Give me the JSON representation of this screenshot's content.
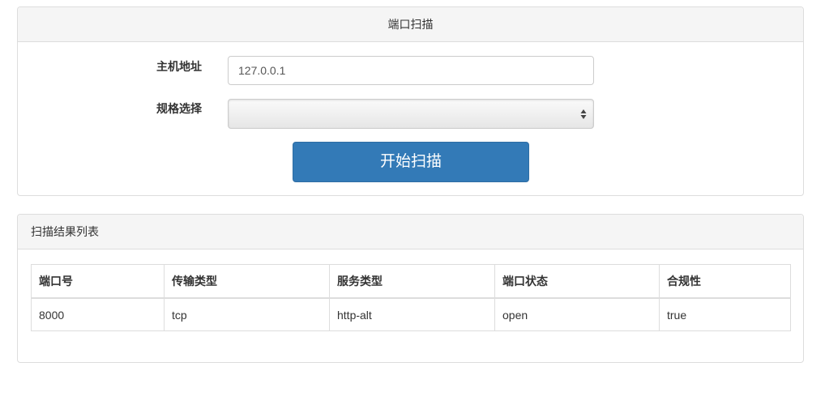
{
  "scan_panel": {
    "title": "端口扫描",
    "host_label": "主机地址",
    "host_value": "127.0.0.1",
    "spec_label": "规格选择",
    "spec_value": "",
    "start_button_label": "开始扫描"
  },
  "results_panel": {
    "title": "扫描结果列表",
    "columns": [
      "端口号",
      "传输类型",
      "服务类型",
      "端口状态",
      "合规性"
    ],
    "rows": [
      [
        "8000",
        "tcp",
        "http-alt",
        "open",
        "true"
      ]
    ]
  },
  "colors": {
    "primary_button": "#337ab7",
    "panel_heading_bg": "#f5f5f5",
    "border": "#dddddd"
  }
}
